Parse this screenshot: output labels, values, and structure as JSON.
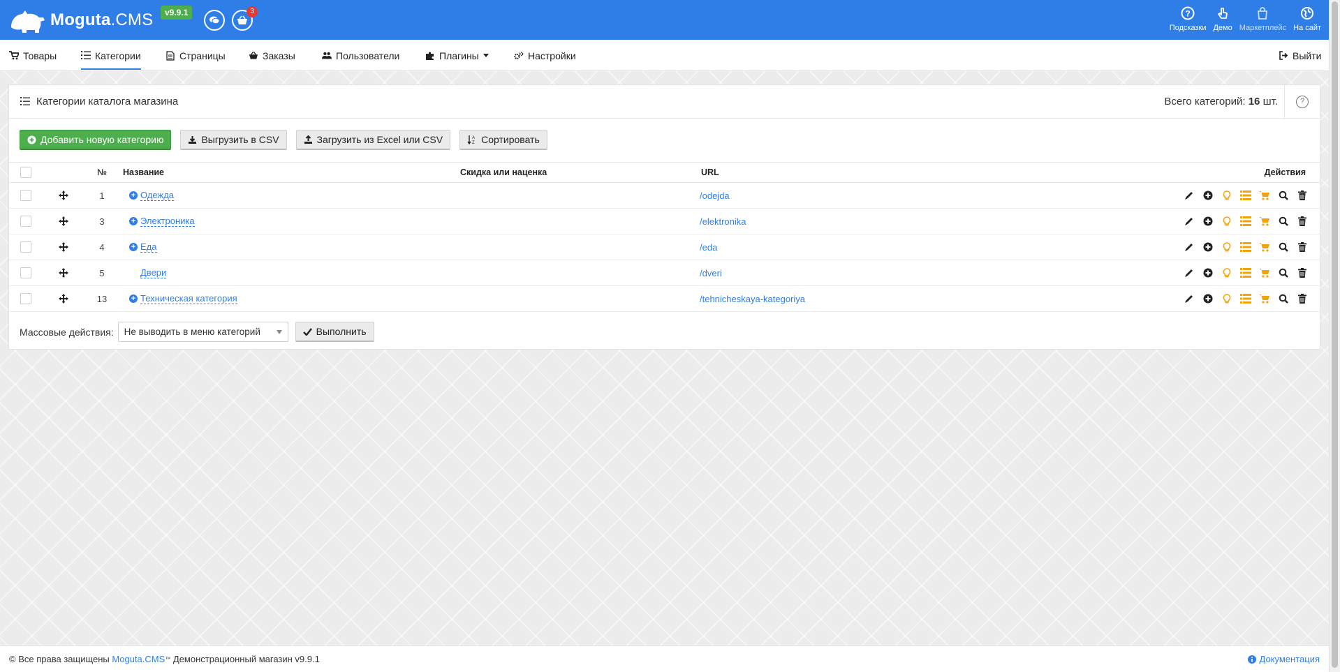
{
  "header": {
    "logo_main": "Moguta",
    "logo_suffix": ".CMS",
    "version": "v9.9.1",
    "orders_badge": "3",
    "right_items": [
      {
        "label": "Подсказки",
        "icon": "question-circle-icon"
      },
      {
        "label": "Демо",
        "icon": "hand-pointer-icon"
      },
      {
        "label": "Маркетплейс",
        "icon": "shopping-bag-icon"
      },
      {
        "label": "На сайт",
        "icon": "globe-icon"
      }
    ]
  },
  "nav": {
    "items": [
      {
        "label": "Товары",
        "icon": "cart-icon"
      },
      {
        "label": "Категории",
        "icon": "list-icon",
        "active": true
      },
      {
        "label": "Страницы",
        "icon": "file-icon"
      },
      {
        "label": "Заказы",
        "icon": "basket-icon"
      },
      {
        "label": "Пользователи",
        "icon": "users-icon"
      },
      {
        "label": "Плагины",
        "icon": "puzzle-icon"
      },
      {
        "label": "Настройки",
        "icon": "gears-icon"
      }
    ],
    "logout": "Выйти"
  },
  "panel": {
    "title": "Категории каталога магазина",
    "count_label": "Всего категорий:",
    "count_value": "16",
    "count_unit": "шт.",
    "help": "?"
  },
  "toolbar": {
    "add": "Добавить новую категорию",
    "export_csv": "Выгрузить в CSV",
    "import": "Загрузить из Excel или CSV",
    "sort": "Сортировать"
  },
  "table": {
    "headers": {
      "num": "№",
      "name": "Название",
      "discount": "Скидка или наценка",
      "url": "URL",
      "actions": "Действия"
    },
    "rows": [
      {
        "num": "1",
        "name": "Одежда",
        "url": "/odejda",
        "has_children": true
      },
      {
        "num": "3",
        "name": "Электроника",
        "url": "/elektronika",
        "has_children": true
      },
      {
        "num": "4",
        "name": "Еда",
        "url": "/eda",
        "has_children": true
      },
      {
        "num": "5",
        "name": "Двери",
        "url": "/dveri",
        "has_children": false
      },
      {
        "num": "13",
        "name": "Техническая категория",
        "url": "/tehnicheskaya-kategoriya",
        "has_children": true
      }
    ]
  },
  "mass": {
    "label": "Массовые действия:",
    "selected": "Не выводить в меню категорий",
    "run": "Выполнить"
  },
  "footer": {
    "copyright": "© Все права защищены",
    "brand": "Moguta.CMS",
    "tm": "™",
    "shop": "Демонстрационный магазин v9.9.1",
    "docs": "Документация"
  },
  "colors": {
    "accent": "#2f7ee8",
    "success": "#4cae4c",
    "badge": "#e53935",
    "warning": "#f0a30a"
  }
}
